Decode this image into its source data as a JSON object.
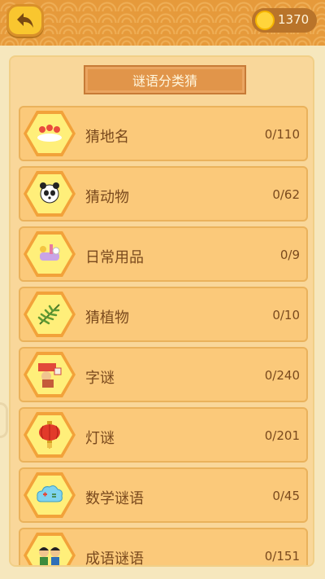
{
  "header": {
    "back_icon": "back-arrow-icon",
    "coins": "1370",
    "coin_icon": "gold-coin-icon"
  },
  "title": "谜语分类猜",
  "categories": [
    {
      "label": "猜地名",
      "count": "0/110",
      "icon": "map-pins-icon"
    },
    {
      "label": "猜动物",
      "count": "0/62",
      "icon": "panda-icon"
    },
    {
      "label": "日常用品",
      "count": "0/9",
      "icon": "daily-goods-icon"
    },
    {
      "label": "猜植物",
      "count": "0/10",
      "icon": "plant-icon"
    },
    {
      "label": "字谜",
      "count": "0/240",
      "icon": "character-riddle-icon"
    },
    {
      "label": "灯谜",
      "count": "0/201",
      "icon": "lantern-icon"
    },
    {
      "label": "数学谜语",
      "count": "0/45",
      "icon": "math-cloud-icon"
    },
    {
      "label": "成语谜语",
      "count": "0/151",
      "icon": "idiom-kids-icon"
    }
  ],
  "colors": {
    "accent": "#e69a3b",
    "text": "#7a4a1e",
    "item_bg": "#fbc97a"
  }
}
